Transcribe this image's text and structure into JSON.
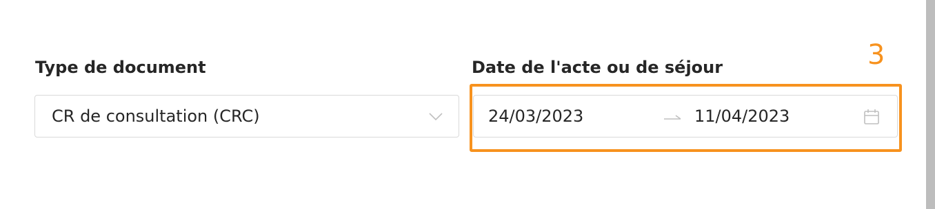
{
  "form": {
    "document_type": {
      "label": "Type de document",
      "value": "CR de consultation (CRC)"
    },
    "date_range": {
      "label": "Date de l'acte ou de séjour",
      "start": "24/03/2023",
      "end": "11/04/2023"
    }
  },
  "annotation": {
    "step": "3",
    "color": "#f7921e"
  },
  "icons": {
    "select_chevron": "chevron-down-icon",
    "range_arrow": "arrow-right-icon",
    "range_calendar": "calendar-icon"
  }
}
